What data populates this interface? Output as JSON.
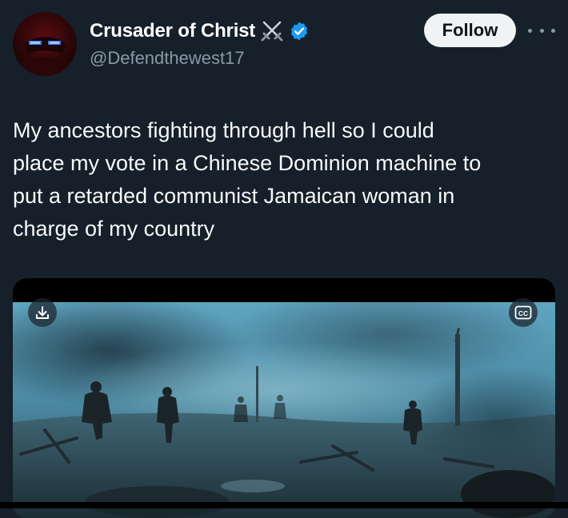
{
  "author": {
    "display_name": "Crusader of Christ",
    "handle": "@Defendthewest17",
    "name_emoji_icon": "crossed-swords-icon",
    "verified_icon": "verified-badge-icon",
    "verified_color": "#1d9bf0"
  },
  "header": {
    "follow_label": "Follow",
    "more_icon": "more-icon"
  },
  "tweet": {
    "text": "My ancestors fighting through hell so I could\nplace my vote in a Chinese Dominion machine to\nput a retarded communist Jamaican woman in\ncharge of my country"
  },
  "media": {
    "download_icon": "download-icon",
    "captions_icon": "closed-captions-icon",
    "captions_label": "CC"
  },
  "colors": {
    "background": "#15202b",
    "text_primary": "#f7f9f9",
    "text_secondary": "#8b98a5",
    "follow_button_bg": "#eff3f4"
  }
}
